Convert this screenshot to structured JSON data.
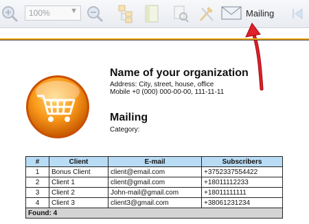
{
  "toolbar": {
    "zoom_value": "100%",
    "mailing_label": "Mailing",
    "icons": [
      "zoom-in-icon",
      "zoom-out-icon",
      "structure-icon",
      "page-icon",
      "settings-icon",
      "tools-icon",
      "envelope-icon",
      "first-page-icon"
    ]
  },
  "report": {
    "org_name": "Name of your organization",
    "address": "Address: City, street, house, office",
    "mobile": "Mobile +0 (000) 000-00-00, 111-11-11",
    "title": "Mailing",
    "category": "Category:"
  },
  "table": {
    "headers": [
      "#",
      "Client",
      "E-mail",
      "Subscribers"
    ],
    "rows": [
      [
        "1",
        "Bonus Client",
        "client@email.com",
        "+3752337554422"
      ],
      [
        "2",
        "Client 1",
        "client@gmail.com",
        "+18011112233"
      ],
      [
        "3",
        "Client 2",
        "John-mail@gmail.com",
        "+18011111111"
      ],
      [
        "4",
        "Client 3",
        "client3@gmail.com",
        "+38061231234"
      ]
    ],
    "footer": "Found: 4"
  },
  "colors": {
    "accent": "#f2a81a",
    "header_bg": "#b9dcf5",
    "arrow": "#e0202a"
  }
}
